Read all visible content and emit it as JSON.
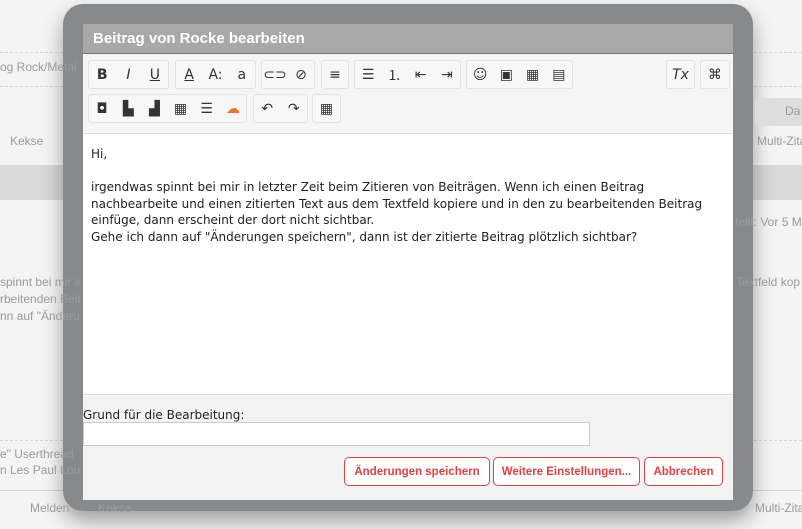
{
  "background": {
    "breadcrumb": "og Rock/Metal",
    "kekse_top": "Kekse",
    "search_placeholder": "Da",
    "multi_quote_top": "Multi-Zita",
    "posted": "tellt: Vor 5 M",
    "line1": "spinnt bei mir ir",
    "line2": "rbeitenden Beit",
    "line3": "nn auf \"Änderu",
    "right_line": "Textfeld kop",
    "thread1": "e\" Userthread",
    "thread2": "n Les Paul Lou I",
    "report": "Melden",
    "kekse_bottom": "Kekse",
    "multi_quote_bottom": "Multi-Zita"
  },
  "dialog": {
    "title": "Beitrag von Rocke bearbeiten",
    "toolbar": {
      "row1": [
        {
          "name": "bold",
          "glyph": "B"
        },
        {
          "name": "italic",
          "glyph": "I"
        },
        {
          "name": "underline",
          "glyph": "U"
        },
        {
          "name": "text-color",
          "glyph": "A"
        },
        {
          "name": "font-size",
          "glyph": "A:"
        },
        {
          "name": "font",
          "glyph": "a"
        },
        {
          "name": "link",
          "glyph": "⊂⊃"
        },
        {
          "name": "unlink",
          "glyph": "⊘"
        },
        {
          "name": "align",
          "glyph": "≡"
        },
        {
          "name": "bullet-list",
          "glyph": "☰"
        },
        {
          "name": "numbered-list",
          "glyph": "⒈"
        },
        {
          "name": "outdent",
          "glyph": "⇤"
        },
        {
          "name": "indent",
          "glyph": "⇥"
        },
        {
          "name": "smiley",
          "glyph": "☺"
        },
        {
          "name": "image",
          "glyph": "▣"
        },
        {
          "name": "media",
          "glyph": "▦"
        },
        {
          "name": "insert-text",
          "glyph": "▤"
        },
        {
          "name": "remove-format",
          "glyph": "Tx"
        },
        {
          "name": "source",
          "glyph": "⌘"
        }
      ],
      "row2": [
        {
          "name": "camera",
          "glyph": "◘"
        },
        {
          "name": "layout-left",
          "glyph": "▙"
        },
        {
          "name": "layout-right",
          "glyph": "▟"
        },
        {
          "name": "layout-grid",
          "glyph": "▦"
        },
        {
          "name": "layout-rows",
          "glyph": "☰"
        },
        {
          "name": "soundcloud",
          "glyph": "☁"
        },
        {
          "name": "undo",
          "glyph": "↶"
        },
        {
          "name": "redo",
          "glyph": "↷"
        },
        {
          "name": "table",
          "glyph": "▦"
        }
      ]
    },
    "content": [
      "Hi,",
      "",
      "irgendwas spinnt bei mir in letzter Zeit beim Zitieren von Beiträgen. Wenn ich einen Beitrag nachbearbeite und einen zitierten Text aus dem Textfeld kopiere und in den zu bearbeitenden Beitrag einfüge, dann erscheint der dort nicht sichtbar.",
      "Gehe ich dann auf \"Änderungen speichern\", dann ist der zitierte Beitrag plötzlich sichtbar?"
    ],
    "reason_label": "Grund für die Bearbeitung:",
    "reason_value": "",
    "buttons": {
      "save": "Änderungen speichern",
      "more": "Weitere Einstellungen...",
      "cancel": "Abbrechen"
    },
    "accent": "#e34040"
  }
}
